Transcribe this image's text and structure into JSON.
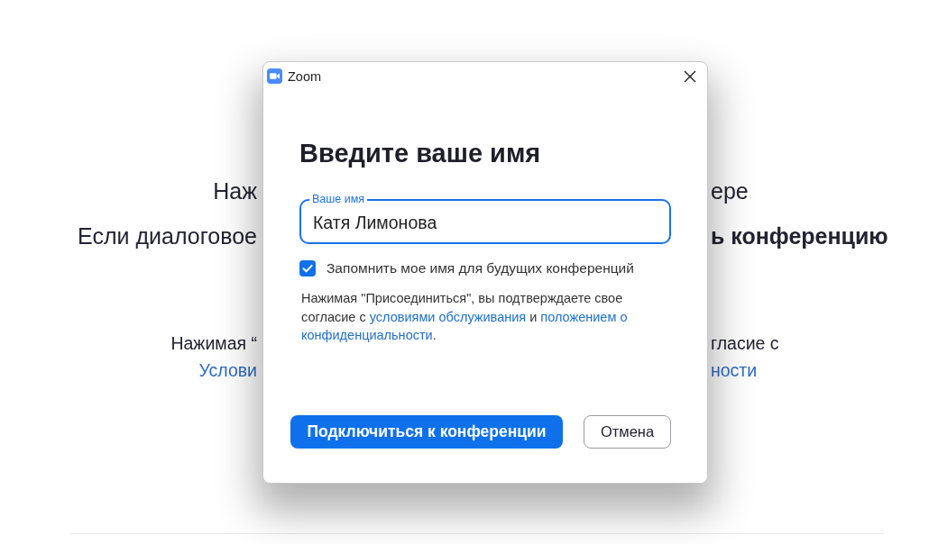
{
  "background_page": {
    "instructions": [
      {
        "left": {
          "text": "Наж",
          "kind": "plain"
        },
        "right": {
          "text": "ере",
          "kind": "plain"
        }
      },
      {
        "left": {
          "text": "Если диалоговое",
          "kind": "plain"
        },
        "right": {
          "text": "ь конференцию",
          "kind": "bold"
        }
      }
    ],
    "terms": [
      {
        "left": {
          "text": "Нажимая “",
          "kind": "plain"
        },
        "right": {
          "text": "гласие с",
          "kind": "plain"
        }
      },
      {
        "left": {
          "text": "Услови",
          "kind": "link"
        },
        "right": {
          "text": "ности",
          "kind": "link"
        }
      }
    ]
  },
  "dialog": {
    "title": "Zoom",
    "heading": "Введите ваше имя",
    "name_field": {
      "label": "Ваше имя",
      "value": "Катя Лимонова",
      "focused": true
    },
    "remember_name": {
      "label": "Запомнить мое имя для будущих конференций",
      "checked": true
    },
    "terms_notice": [
      {
        "text": "Нажимая \"Присоединиться\", вы подтверждаете свое согласие с ",
        "kind": "text"
      },
      {
        "text": "условиями обслуживания",
        "kind": "link"
      },
      {
        "text": " и ",
        "kind": "text"
      },
      {
        "text": "положением о",
        "kind": "link"
      },
      {
        "text": "конфиденциальности",
        "kind": "link"
      },
      {
        "text": ".",
        "kind": "text"
      }
    ],
    "buttons": [
      {
        "label": "Подключиться к конференции",
        "kind": "primary"
      },
      {
        "label": "Отмена",
        "kind": "secondary"
      }
    ]
  }
}
